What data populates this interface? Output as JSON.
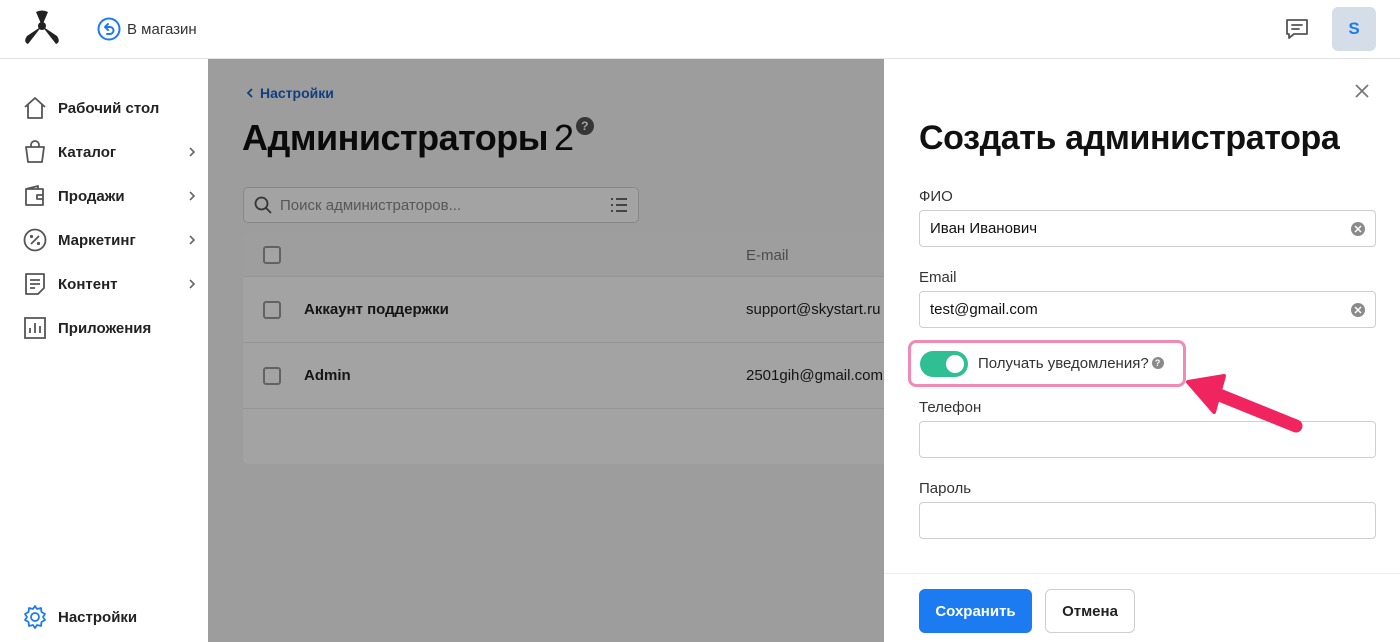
{
  "topbar": {
    "store_link": "В магазин",
    "avatar_letter": "S"
  },
  "sidebar": {
    "items": [
      {
        "label": "Рабочий стол",
        "icon": "home-icon",
        "has_submenu": false
      },
      {
        "label": "Каталог",
        "icon": "bag-icon",
        "has_submenu": true
      },
      {
        "label": "Продажи",
        "icon": "wallet-icon",
        "has_submenu": true
      },
      {
        "label": "Маркетинг",
        "icon": "percent-icon",
        "has_submenu": true
      },
      {
        "label": "Контент",
        "icon": "document-icon",
        "has_submenu": true
      },
      {
        "label": "Приложения",
        "icon": "chart-icon",
        "has_submenu": false
      }
    ],
    "settings_label": "Настройки"
  },
  "main": {
    "breadcrumb": "Настройки",
    "title": "Администраторы",
    "count": "2",
    "search_placeholder": "Поиск администраторов...",
    "table": {
      "email_header": "E-mail",
      "rows": [
        {
          "name": "Аккаунт поддержки",
          "email": "support@skystart.ru"
        },
        {
          "name": "Admin",
          "email": "2501gih@gmail.com"
        }
      ]
    }
  },
  "drawer": {
    "title": "Создать администратора",
    "fields": {
      "name_label": "ФИО",
      "name_value": "Иван Иванович",
      "email_label": "Email",
      "email_value": "test@gmail.com",
      "notify_label": "Получать уведомления?",
      "notify_on": true,
      "phone_label": "Телефон",
      "phone_value": "",
      "password_label": "Пароль",
      "password_value": ""
    },
    "save_label": "Сохранить",
    "cancel_label": "Отмена"
  },
  "colors": {
    "accent": "#1d7bf2",
    "toggle_on": "#2fbf92",
    "highlight": "#f18bb6",
    "annotation_arrow": "#f0245e"
  }
}
